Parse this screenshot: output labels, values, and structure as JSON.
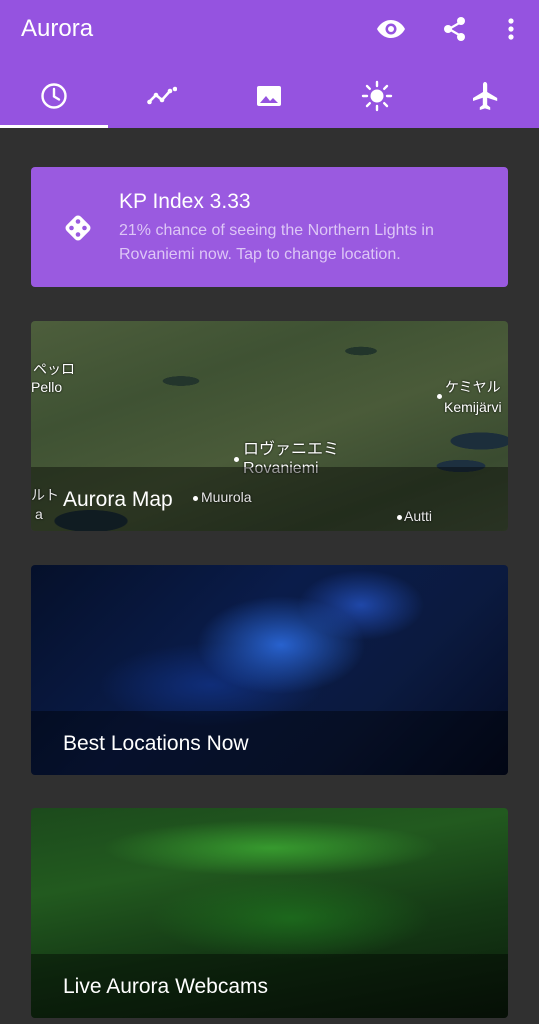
{
  "app": {
    "title": "Aurora"
  },
  "actions": {
    "view_icon": "eye-icon",
    "share_icon": "share-icon",
    "more_icon": "more-vert-icon"
  },
  "tabs": [
    {
      "icon": "clock-icon",
      "active": true
    },
    {
      "icon": "trend-icon",
      "active": false
    },
    {
      "icon": "image-icon",
      "active": false
    },
    {
      "icon": "sun-icon",
      "active": false
    },
    {
      "icon": "airplane-icon",
      "active": false
    }
  ],
  "kp_card": {
    "icon": "dice-icon",
    "title": "KP Index 3.33",
    "description": "21% chance of seeing the Northern Lights in Rovaniemi now. Tap to change location."
  },
  "map_card": {
    "label": "Aurora Map",
    "places": {
      "pello_jp": "ペッロ",
      "pello": "Pello",
      "kemijarvi_jp": "ケミヤル",
      "kemijarvi": "Kemijärvi",
      "rovaniemi_jp": "ロヴァニエミ",
      "rovaniemi": "Rovaniemi",
      "muurola": "Muurola",
      "aavasaksa_jp": "ルト",
      "aavasaksa": "a",
      "autti": "Autti"
    }
  },
  "best_card": {
    "label": "Best Locations Now"
  },
  "live_card": {
    "label": "Live Aurora Webcams"
  },
  "colors": {
    "primary": "#9553e0",
    "card": "#9a5ae0",
    "background": "#303030"
  }
}
